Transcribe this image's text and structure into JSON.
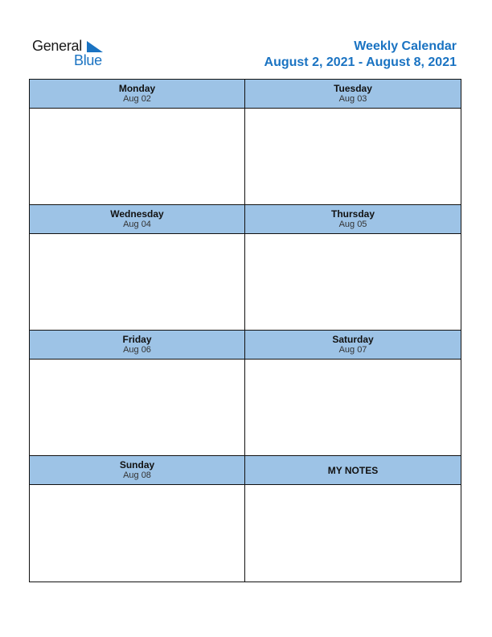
{
  "logo": {
    "word1": "General",
    "word2": "Blue"
  },
  "header": {
    "title": "Weekly Calendar",
    "range": "August 2, 2021 - August 8, 2021"
  },
  "colors": {
    "accent": "#1a73c2",
    "header_fill": "#9dc3e6",
    "border": "#111111"
  },
  "days": [
    {
      "day": "Monday",
      "date": "Aug 02"
    },
    {
      "day": "Tuesday",
      "date": "Aug 03"
    },
    {
      "day": "Wednesday",
      "date": "Aug 04"
    },
    {
      "day": "Thursday",
      "date": "Aug 05"
    },
    {
      "day": "Friday",
      "date": "Aug 06"
    },
    {
      "day": "Saturday",
      "date": "Aug 07"
    },
    {
      "day": "Sunday",
      "date": "Aug 08"
    }
  ],
  "notes": {
    "label": "MY NOTES"
  }
}
